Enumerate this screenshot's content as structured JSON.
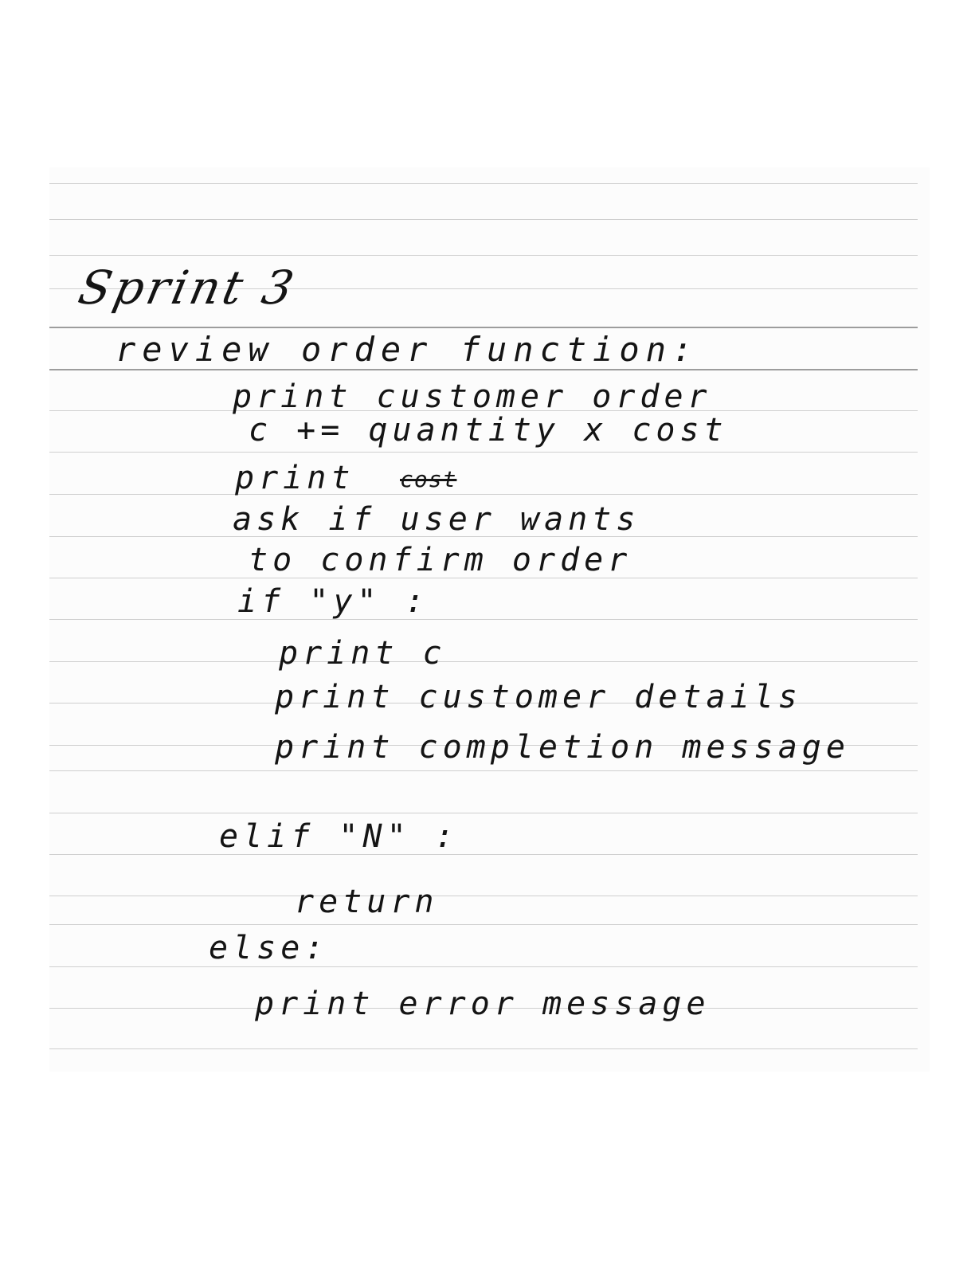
{
  "note": {
    "title": "Sprint 3",
    "heading": "review order function:",
    "lines": [
      "print customer order",
      "c += quantity x cost",
      "print",
      "cost",
      "ask if user wants",
      "to confirm order",
      "if \"y\" :",
      "print c",
      "print customer details",
      "print completion message",
      "elif \"N\" :",
      "return",
      "else:",
      "print error message"
    ]
  }
}
